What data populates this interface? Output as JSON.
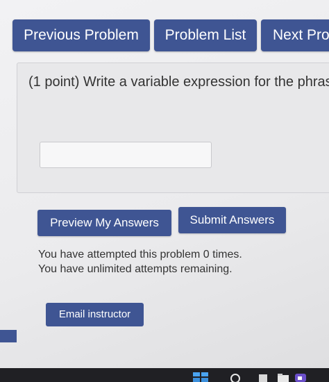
{
  "nav": {
    "previous_label": "Previous Problem",
    "list_label": "Problem List",
    "next_label": "Next Prol"
  },
  "problem": {
    "prompt": "(1 point) Write a variable expression for the phrase",
    "answer_value": ""
  },
  "actions": {
    "preview_label": "Preview My Answers",
    "submit_label": "Submit Answers"
  },
  "attempts": {
    "line1": "You have attempted this problem 0 times.",
    "line2": "You have unlimited attempts remaining."
  },
  "email": {
    "label": "Email instructor"
  },
  "taskbar": {
    "icons": [
      "windows-start-icon",
      "search-icon",
      "task-view-icon",
      "file-explorer-icon",
      "meet-icon"
    ]
  },
  "colors": {
    "button_blue": "#3f5593",
    "taskbar": "#202024"
  }
}
